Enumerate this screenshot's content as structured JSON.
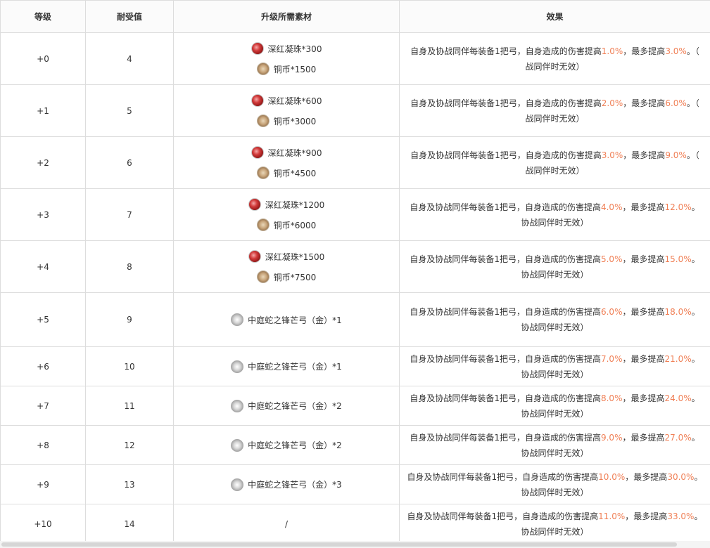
{
  "headers": [
    "等级",
    "耐受值",
    "升级所需素材",
    "效果"
  ],
  "rows": [
    {
      "level": "+0",
      "tolerance": "4",
      "materials": [
        {
          "icon": "crimson-bead-icon",
          "text": "深红凝珠*300"
        },
        {
          "icon": "copper-coin-icon",
          "text": "铜币*1500"
        }
      ],
      "effect": {
        "pre": "自身及协战同伴每装备1把弓，自身造成的伤害提高",
        "v1": "1.0%",
        "mid": "，最多提高",
        "v2": "3.0%",
        "post": "。（",
        "line2": "战同伴时无效）"
      }
    },
    {
      "level": "+1",
      "tolerance": "5",
      "materials": [
        {
          "icon": "crimson-bead-icon",
          "text": "深红凝珠*600"
        },
        {
          "icon": "copper-coin-icon",
          "text": "铜币*3000"
        }
      ],
      "effect": {
        "pre": "自身及协战同伴每装备1把弓，自身造成的伤害提高",
        "v1": "2.0%",
        "mid": "，最多提高",
        "v2": "6.0%",
        "post": "。（",
        "line2": "战同伴时无效）"
      }
    },
    {
      "level": "+2",
      "tolerance": "6",
      "materials": [
        {
          "icon": "crimson-bead-icon",
          "text": "深红凝珠*900"
        },
        {
          "icon": "copper-coin-icon",
          "text": "铜币*4500"
        }
      ],
      "effect": {
        "pre": "自身及协战同伴每装备1把弓，自身造成的伤害提高",
        "v1": "3.0%",
        "mid": "，最多提高",
        "v2": "9.0%",
        "post": "。（",
        "line2": "战同伴时无效）"
      }
    },
    {
      "level": "+3",
      "tolerance": "7",
      "materials": [
        {
          "icon": "crimson-bead-icon",
          "text": "深红凝珠*1200"
        },
        {
          "icon": "copper-coin-icon",
          "text": "铜币*6000"
        }
      ],
      "effect": {
        "pre": "自身及协战同伴每装备1把弓，自身造成的伤害提高",
        "v1": "4.0%",
        "mid": "，最多提高",
        "v2": "12.0%",
        "post": "。",
        "line2": "协战同伴时无效）"
      }
    },
    {
      "level": "+4",
      "tolerance": "8",
      "materials": [
        {
          "icon": "crimson-bead-icon",
          "text": "深红凝珠*1500"
        },
        {
          "icon": "copper-coin-icon",
          "text": "铜币*7500"
        }
      ],
      "effect": {
        "pre": "自身及协战同伴每装备1把弓，自身造成的伤害提高",
        "v1": "5.0%",
        "mid": "，最多提高",
        "v2": "15.0%",
        "post": "。",
        "line2": "协战同伴时无效）"
      }
    },
    {
      "level": "+5",
      "tolerance": "9",
      "materials": [
        {
          "icon": "bow-medal-icon",
          "text": "中庭蛇之锋芒弓（金）*1"
        }
      ],
      "effect": {
        "pre": "自身及协战同伴每装备1把弓，自身造成的伤害提高",
        "v1": "6.0%",
        "mid": "，最多提高",
        "v2": "18.0%",
        "post": "。",
        "line2": "协战同伴时无效）"
      }
    },
    {
      "level": "+6",
      "tolerance": "10",
      "materials": [
        {
          "icon": "bow-medal-icon",
          "text": "中庭蛇之锋芒弓（金）*1"
        }
      ],
      "effect": {
        "pre": "自身及协战同伴每装备1把弓，自身造成的伤害提高",
        "v1": "7.0%",
        "mid": "，最多提高",
        "v2": "21.0%",
        "post": "。",
        "line2": "协战同伴时无效）"
      }
    },
    {
      "level": "+7",
      "tolerance": "11",
      "materials": [
        {
          "icon": "bow-medal-icon",
          "text": "中庭蛇之锋芒弓（金）*2"
        }
      ],
      "effect": {
        "pre": "自身及协战同伴每装备1把弓，自身造成的伤害提高",
        "v1": "8.0%",
        "mid": "，最多提高",
        "v2": "24.0%",
        "post": "。",
        "line2": "协战同伴时无效）"
      }
    },
    {
      "level": "+8",
      "tolerance": "12",
      "materials": [
        {
          "icon": "bow-medal-icon",
          "text": "中庭蛇之锋芒弓（金）*2"
        }
      ],
      "effect": {
        "pre": "自身及协战同伴每装备1把弓，自身造成的伤害提高",
        "v1": "9.0%",
        "mid": "，最多提高",
        "v2": "27.0%",
        "post": "。",
        "line2": "协战同伴时无效）"
      }
    },
    {
      "level": "+9",
      "tolerance": "13",
      "materials": [
        {
          "icon": "bow-medal-icon",
          "text": "中庭蛇之锋芒弓（金）*3"
        }
      ],
      "effect": {
        "pre": "自身及协战同伴每装备1把弓，自身造成的伤害提高",
        "v1": "10.0%",
        "mid": "，最多提高",
        "v2": "30.0%",
        "post": "。",
        "line2": "协战同伴时无效）"
      }
    },
    {
      "level": "+10",
      "tolerance": "14",
      "materials": [
        {
          "icon": "",
          "text": "/"
        }
      ],
      "effect": {
        "pre": "自身及协战同伴每装备1把弓，自身造成的伤害提高",
        "v1": "11.0%",
        "mid": "，最多提高",
        "v2": "33.0%",
        "post": "。",
        "line2": "协战同伴时无效）"
      }
    }
  ],
  "colors": {
    "highlight": "#f07f55",
    "border": "#dddddd",
    "text": "#333333"
  }
}
